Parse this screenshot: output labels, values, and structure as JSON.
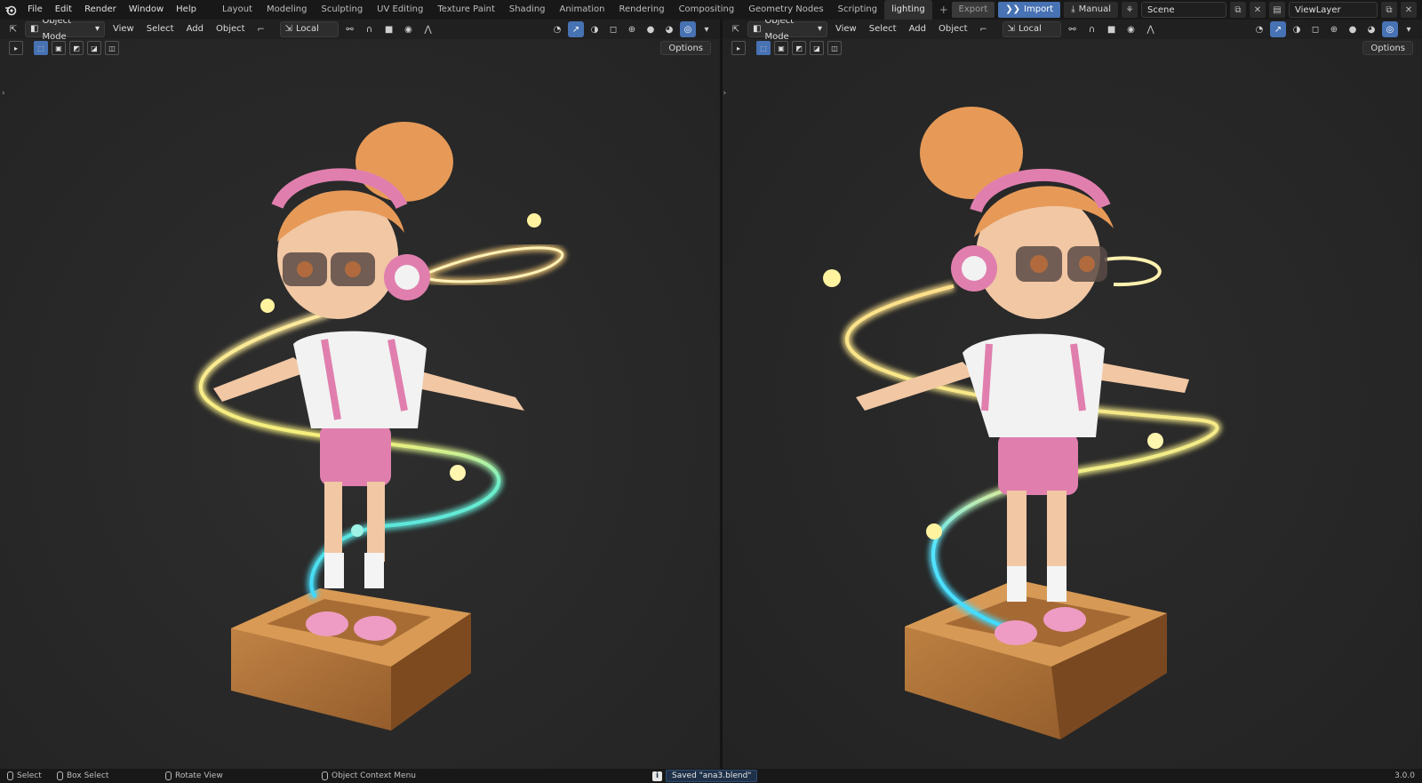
{
  "app": {
    "menu": [
      "File",
      "Edit",
      "Render",
      "Window",
      "Help"
    ],
    "workspaces": [
      "Layout",
      "Modeling",
      "Sculpting",
      "UV Editing",
      "Texture Paint",
      "Shading",
      "Animation",
      "Rendering",
      "Compositing",
      "Geometry Nodes",
      "Scripting",
      "lighting"
    ],
    "active_workspace": "lighting",
    "add_tab": "+",
    "export_label": "Export",
    "import_label": "Import",
    "manual_label": "Manual",
    "scene_name": "Scene",
    "view_layer": "ViewLayer"
  },
  "viewport_left": {
    "mode": "Object Mode",
    "menus": [
      "View",
      "Select",
      "Add",
      "Object"
    ],
    "transform_orientation": "Local",
    "options_label": "Options"
  },
  "viewport_right": {
    "mode": "Object Mode",
    "menus": [
      "View",
      "Select",
      "Add",
      "Object"
    ],
    "transform_orientation": "Local",
    "options_label": "Options"
  },
  "status": {
    "select": "Select",
    "box_select": "Box Select",
    "rotate_view": "Rotate View",
    "context_menu": "Object Context Menu",
    "message": "Saved \"ana3.blend\"",
    "version": "3.0.0"
  },
  "colors": {
    "accent": "#4772b3",
    "background": "#2a2a2a",
    "topbar": "#181818"
  }
}
